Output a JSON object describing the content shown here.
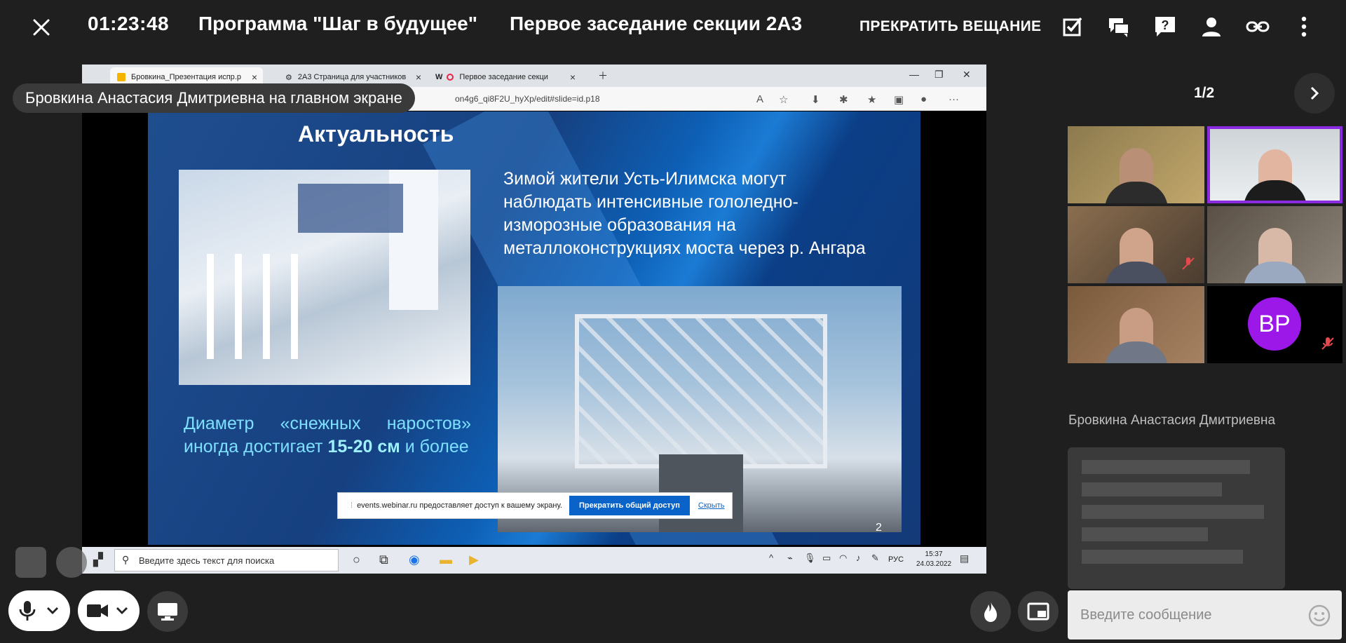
{
  "topbar": {
    "timer": "01:23:48",
    "title": "Программа \"Шаг в будущее\"",
    "subtitle": "Первое заседание секции 2А3",
    "stop_broadcast_label": "ПРЕКРАТИТЬ ВЕЩАНИЕ",
    "icons": [
      "close-icon",
      "task-check-icon",
      "chat-icon",
      "question-icon",
      "person-icon",
      "link-icon",
      "more-vert-icon"
    ]
  },
  "presenter_banner": "Бровкина Анастасия Дмитриевна на главном экране",
  "shared_screen": {
    "browser_tabs": [
      {
        "label": "Бровкина_Презентация испр.p"
      },
      {
        "label": "2А3 Страница для участников"
      },
      {
        "label": "Первое заседание секци"
      }
    ],
    "url": "on4g6_qi8F2U_hyXp/edit#slide=id.p18",
    "slide": {
      "title": "Актуальность",
      "text_main": "Зимой жители Усть-Илимска могут наблюдать интенсивные гололедно-изморозные образования на металлоконструкциях моста через р. Ангара",
      "text_diameter_prefix": "Диаметр «снежных наростов» иногда достигает ",
      "text_diameter_bold": "15-20 см",
      "text_diameter_suffix": " и более",
      "page_number": "2"
    },
    "share_notice": {
      "text": "events.webinar.ru предоставляет доступ к вашему экрану.",
      "stop_label": "Прекратить общий доступ",
      "hide_label": "Скрыть"
    },
    "taskbar": {
      "search_placeholder": "Введите здесь текст для поиска",
      "lang": "РУС",
      "time": "15:37",
      "date": "24.03.2022"
    }
  },
  "participants": {
    "page_indicator": "1/2",
    "avatar_initials": "BP",
    "speaker_name": "Бровкина Анастасия Дмитриевна"
  },
  "chat": {
    "input_placeholder": "Введите сообщение"
  },
  "colors": {
    "background": "#1f1f1f",
    "accent_active_tile": "#8a2be2",
    "avatar": "#9b18e8",
    "mute": "#e5484d"
  }
}
